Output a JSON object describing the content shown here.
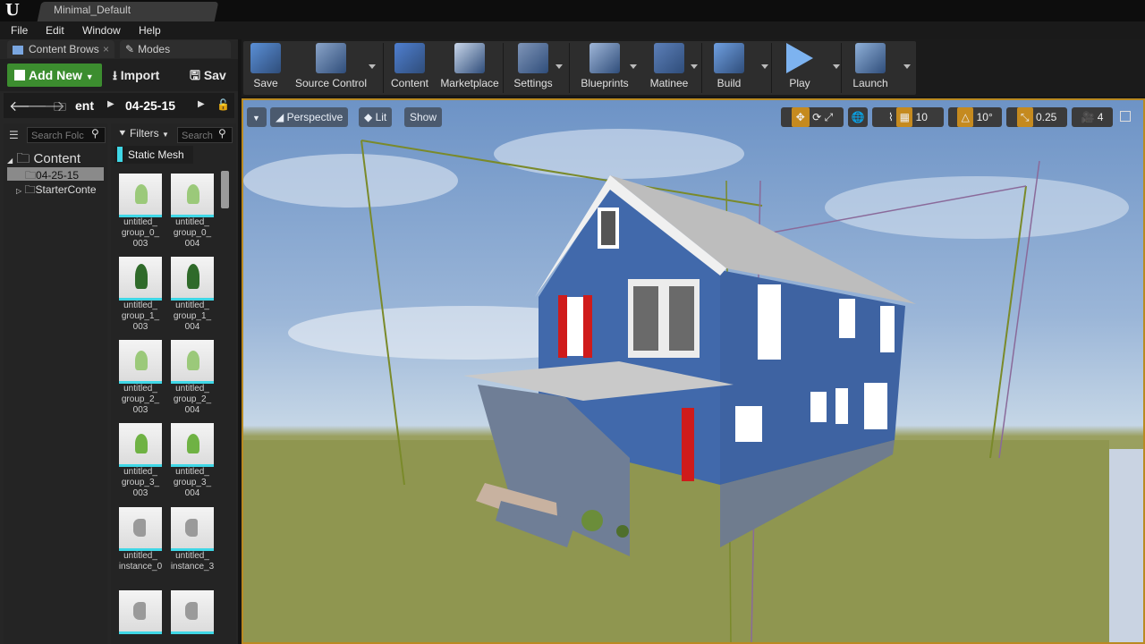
{
  "window": {
    "tab_title": "Minimal_Default"
  },
  "menu": [
    "File",
    "Edit",
    "Window",
    "Help"
  ],
  "left_tabs": {
    "content_browser": "Content Brows",
    "modes": "Modes"
  },
  "cb_toolbar": {
    "add_new": "Add New",
    "import": "Import",
    "save": "Sav"
  },
  "path": {
    "segment1": "ent",
    "segment2": "04-25-15"
  },
  "search": {
    "folders_placeholder": "Search Folc",
    "assets_placeholder": "Search"
  },
  "tree": {
    "root": "Content",
    "items": [
      "04-25-15",
      "StarterConte"
    ]
  },
  "filters": {
    "label": "Filters",
    "active_filter": "Static Mesh"
  },
  "assets": [
    {
      "label": "untitled_\ngroup_0_\n003",
      "kind": "plant"
    },
    {
      "label": "untitled_\ngroup_0_\n004",
      "kind": "plant"
    },
    {
      "label": "untitled_\ngroup_1_\n003",
      "kind": "bush"
    },
    {
      "label": "untitled_\ngroup_1_\n004",
      "kind": "bush"
    },
    {
      "label": "untitled_\ngroup_2_\n003",
      "kind": "plant"
    },
    {
      "label": "untitled_\ngroup_2_\n004",
      "kind": "plant"
    },
    {
      "label": "untitled_\ngroup_3_\n003",
      "kind": "plant2"
    },
    {
      "label": "untitled_\ngroup_3_\n004",
      "kind": "plant2"
    },
    {
      "label": "untitled_\ninstance_0",
      "kind": "cylinder"
    },
    {
      "label": "untitled_\ninstance_3",
      "kind": "cylinder"
    },
    {
      "label": "",
      "kind": "cylinder"
    },
    {
      "label": "",
      "kind": "cylinder"
    }
  ],
  "toolbar": [
    {
      "label": "Save",
      "icon": "save-icon",
      "color": "#5a8fd6"
    },
    {
      "label": "Source Control",
      "icon": "source-control-icon",
      "color": "#8aa4c8"
    },
    {
      "label": "Content",
      "icon": "content-icon",
      "color": "#4f7fd0"
    },
    {
      "label": "Marketplace",
      "icon": "marketplace-icon",
      "color": "#c9d6ea"
    },
    {
      "label": "Settings",
      "icon": "settings-icon",
      "color": "#7f95b8"
    },
    {
      "label": "Blueprints",
      "icon": "blueprints-icon",
      "color": "#9fb6d8"
    },
    {
      "label": "Matinee",
      "icon": "matinee-icon",
      "color": "#5c7fb8"
    },
    {
      "label": "Build",
      "icon": "build-icon",
      "color": "#6f9fe0"
    },
    {
      "label": "Play",
      "icon": "play-icon",
      "color": "#7db3f0"
    },
    {
      "label": "Launch",
      "icon": "launch-icon",
      "color": "#8fb0d8"
    }
  ],
  "viewport": {
    "perspective": "Perspective",
    "lit": "Lit",
    "show": "Show",
    "grid_snap": "10",
    "rotation_snap": "10°",
    "scale_snap": "0.25",
    "camera_speed": "4"
  }
}
